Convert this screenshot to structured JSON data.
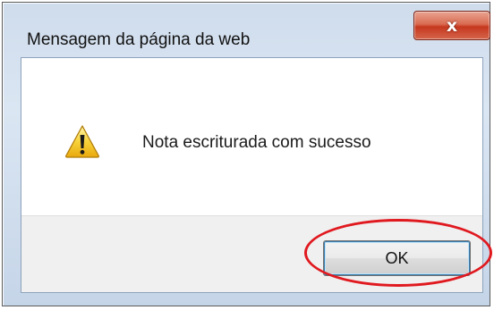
{
  "window": {
    "title": "Mensagem da página da web",
    "close_label": "x"
  },
  "dialog": {
    "icon": "warning-icon",
    "message": "Nota escriturada com sucesso"
  },
  "buttons": {
    "ok_label": "OK"
  },
  "colors": {
    "annotation": "#e0191f",
    "close_button": "#c5381f",
    "frame": "#cfdcec"
  }
}
